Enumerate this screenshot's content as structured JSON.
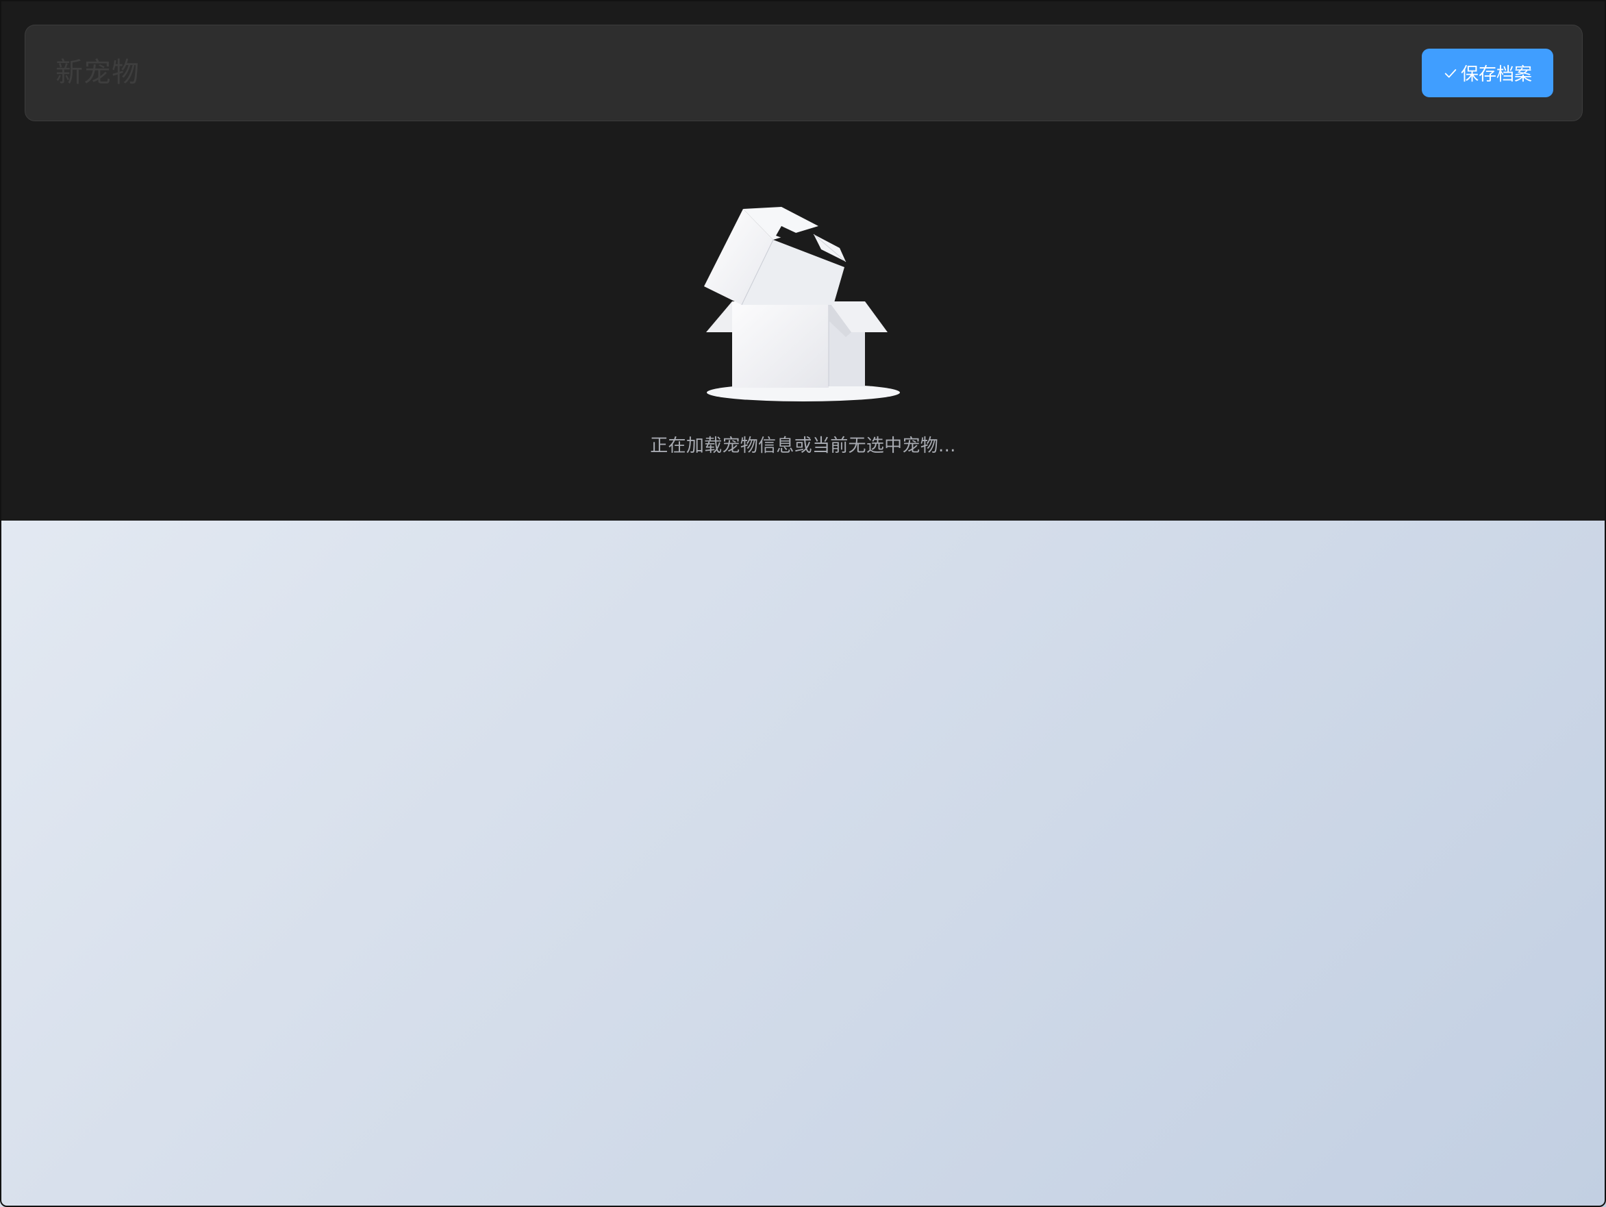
{
  "header": {
    "title": "新宠物",
    "save_label": "保存档案"
  },
  "empty_state": {
    "message": "正在加载宠物信息或当前无选中宠物..."
  },
  "icons": {
    "save": "check-icon",
    "empty": "empty-box-icon"
  },
  "colors": {
    "primary": "#409eff",
    "panel_bg": "#1b1b1b",
    "header_bg": "#2e2e2e",
    "muted_text": "#a8abb2",
    "title_text": "#3e3e3e"
  }
}
